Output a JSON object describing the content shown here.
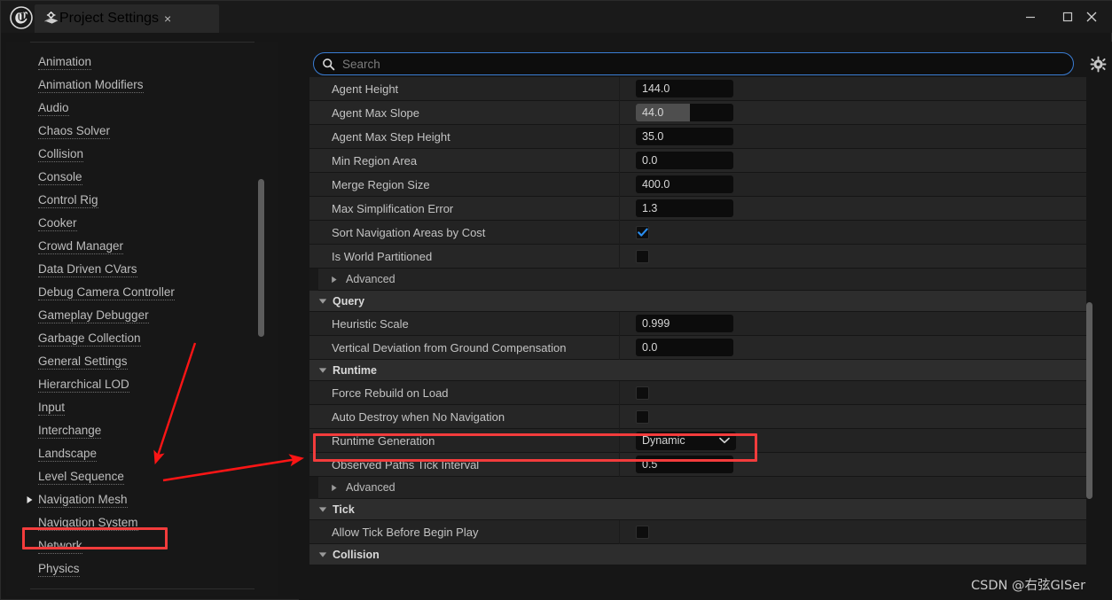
{
  "window": {
    "tab_title": "Project Settings",
    "tab_icon": "settings-gear-document-icon",
    "app_logo": "unreal-engine-logo",
    "close_tab_label": "×",
    "minimize_label": "—",
    "maximize_label": "□",
    "close_label": "✕"
  },
  "search": {
    "placeholder": "Search",
    "value": "",
    "icon": "search-icon",
    "settings_icon": "gear-icon"
  },
  "sidebar": {
    "items": [
      {
        "label": "Animation",
        "expandable": false
      },
      {
        "label": "Animation Modifiers",
        "expandable": false
      },
      {
        "label": "Audio",
        "expandable": false
      },
      {
        "label": "Chaos Solver",
        "expandable": false
      },
      {
        "label": "Collision",
        "expandable": false
      },
      {
        "label": "Console",
        "expandable": false
      },
      {
        "label": "Control Rig",
        "expandable": false
      },
      {
        "label": "Cooker",
        "expandable": false
      },
      {
        "label": "Crowd Manager",
        "expandable": false
      },
      {
        "label": "Data Driven CVars",
        "expandable": false
      },
      {
        "label": "Debug Camera Controller",
        "expandable": false
      },
      {
        "label": "Gameplay Debugger",
        "expandable": false
      },
      {
        "label": "Garbage Collection",
        "expandable": false
      },
      {
        "label": "General Settings",
        "expandable": false
      },
      {
        "label": "Hierarchical LOD",
        "expandable": false
      },
      {
        "label": "Input",
        "expandable": false
      },
      {
        "label": "Interchange",
        "expandable": false
      },
      {
        "label": "Landscape",
        "expandable": false
      },
      {
        "label": "Level Sequence",
        "expandable": false
      },
      {
        "label": "Navigation Mesh",
        "expandable": true,
        "highlighted": true
      },
      {
        "label": "Navigation System",
        "expandable": false
      },
      {
        "label": "Network",
        "expandable": false
      },
      {
        "label": "Physics",
        "expandable": false
      }
    ]
  },
  "properties": {
    "rows": [
      {
        "kind": "prop",
        "label": "Agent Height",
        "control": "number",
        "value": "144.0",
        "fill_pct": 0
      },
      {
        "kind": "prop",
        "label": "Agent Max Slope",
        "control": "number",
        "value": "44.0",
        "fill_pct": 55
      },
      {
        "kind": "prop",
        "label": "Agent Max Step Height",
        "control": "number",
        "value": "35.0",
        "fill_pct": 0
      },
      {
        "kind": "prop",
        "label": "Min Region Area",
        "control": "number",
        "value": "0.0",
        "fill_pct": 0
      },
      {
        "kind": "prop",
        "label": "Merge Region Size",
        "control": "number",
        "value": "400.0",
        "fill_pct": 0
      },
      {
        "kind": "prop",
        "label": "Max Simplification Error",
        "control": "number",
        "value": "1.3",
        "fill_pct": 0
      },
      {
        "kind": "prop",
        "label": "Sort Navigation Areas by Cost",
        "control": "checkbox",
        "checked": true
      },
      {
        "kind": "prop",
        "label": "Is World Partitioned",
        "control": "checkbox",
        "checked": false
      },
      {
        "kind": "advanced",
        "label": "Advanced",
        "expanded": false
      },
      {
        "kind": "category",
        "label": "Query",
        "expanded": true
      },
      {
        "kind": "prop",
        "label": "Heuristic Scale",
        "control": "number",
        "value": "0.999",
        "fill_pct": 0
      },
      {
        "kind": "prop",
        "label": "Vertical Deviation from Ground Compensation",
        "control": "number",
        "value": "0.0",
        "fill_pct": 0
      },
      {
        "kind": "category",
        "label": "Runtime",
        "expanded": true
      },
      {
        "kind": "prop",
        "label": "Force Rebuild on Load",
        "control": "checkbox",
        "checked": false
      },
      {
        "kind": "prop",
        "label": "Auto Destroy when No Navigation",
        "control": "checkbox",
        "checked": false
      },
      {
        "kind": "prop",
        "label": "Runtime Generation",
        "control": "dropdown",
        "value": "Dynamic",
        "highlighted": true
      },
      {
        "kind": "prop",
        "label": "Observed Paths Tick Interval",
        "control": "number",
        "value": "0.5",
        "fill_pct": 0
      },
      {
        "kind": "advanced",
        "label": "Advanced",
        "expanded": false
      },
      {
        "kind": "category",
        "label": "Tick",
        "expanded": true
      },
      {
        "kind": "prop",
        "label": "Allow Tick Before Begin Play",
        "control": "checkbox",
        "checked": false
      },
      {
        "kind": "category",
        "label": "Collision",
        "expanded": true
      }
    ]
  },
  "annotations": {
    "accent_color": "#f33c3c",
    "arrow_1": {
      "name": "arrow-to-navigation-mesh"
    },
    "arrow_2": {
      "name": "arrow-to-runtime-generation"
    },
    "nav_highlight_target": "Navigation Mesh",
    "prop_highlight_target": "Runtime Generation"
  },
  "watermark": {
    "text": "CSDN @右弦GISer"
  }
}
